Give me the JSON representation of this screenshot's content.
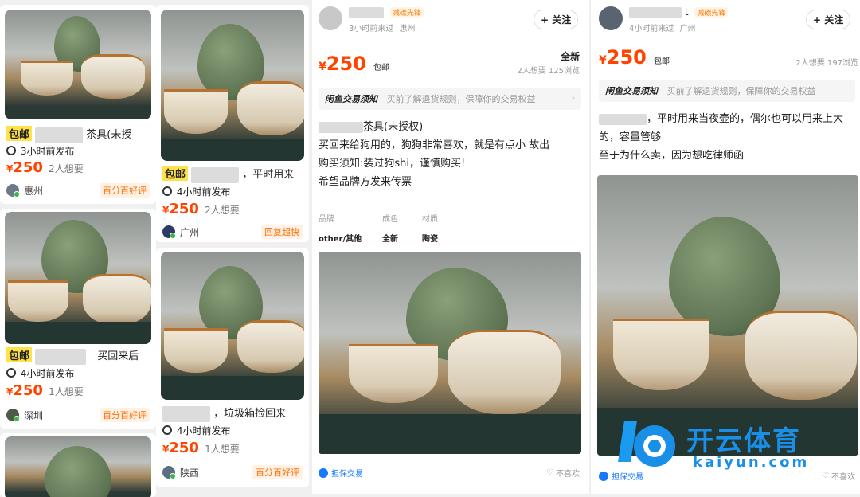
{
  "col1": {
    "cards": [
      {
        "title_tag": "包邮",
        "title": "茶具(未授",
        "time": "3小时前发布",
        "price": "250",
        "want": "2人想要",
        "location": "惠州",
        "badge": "百分百好评"
      },
      {
        "title_tag": "包邮",
        "title": "买回来后",
        "time": "4小时前发布",
        "price": "250",
        "want": "1人想要",
        "location": "深圳",
        "badge": "百分百好评"
      }
    ]
  },
  "col2": {
    "cards": [
      {
        "title_tag": "包邮",
        "title": "，平时用来",
        "time": "4小时前发布",
        "price": "250",
        "want": "2人想要",
        "location": "广州",
        "badge": "回复超快"
      },
      {
        "title": "，垃圾箱捡回来",
        "time": "4小时前发布",
        "price": "250",
        "want": "1人想要",
        "location": "陕西",
        "badge": "百分百好评"
      }
    ]
  },
  "detail1": {
    "carbon": "减碳先锋",
    "last_seen": "3小时前来过",
    "city": "惠州",
    "follow": "+ 关注",
    "currency": "¥",
    "price": "250",
    "shipping": "包邮",
    "condition": "全新",
    "stats": "2人想要  125浏览",
    "notice_title": "闲鱼交易须知",
    "notice_text": "买前了解退货规则，保障你的交易权益",
    "desc_lines": [
      "茶具(未授权)",
      "买回来给狗用的，狗狗非常喜欢，就是有点小 故出",
      "购买须知:装过狗shi，谨慎购买!",
      "希望品牌方发来传票"
    ],
    "attrs": [
      {
        "label": "品牌",
        "value": "other/其他"
      },
      {
        "label": "成色",
        "value": "全新"
      },
      {
        "label": "材质",
        "value": "陶瓷"
      }
    ],
    "guarantee": "担保交易",
    "dislike": "不喜欢"
  },
  "detail2": {
    "name_suffix": "t",
    "carbon": "减碳先锋",
    "last_seen": "4小时前来过",
    "city": "广州",
    "follow": "+ 关注",
    "currency": "¥",
    "price": "250",
    "shipping": "包邮",
    "stats": "2人想要  197浏览",
    "notice_title": "闲鱼交易须知",
    "notice_text": "买前了解退货规则，保障你的交易权益",
    "desc_lines": [
      "，平时用来当夜壶的，偶尔也可以用来上大",
      "的，容量管够",
      "至于为什么卖，因为想吃律师函"
    ],
    "guarantee": "担保交易",
    "dislike": "不喜欢"
  },
  "watermark": {
    "brand": "开云体育",
    "url": "kaiyun.com"
  },
  "icons": [
    "clock-icon",
    "avatar-icon",
    "shield-icon",
    "heart-icon",
    "chevron-right-icon",
    "plus-icon"
  ],
  "colors": {
    "price": "#ff4400",
    "tag": "#ffe14a",
    "badge": "#ff6a00",
    "guarantee": "#1677ff"
  }
}
